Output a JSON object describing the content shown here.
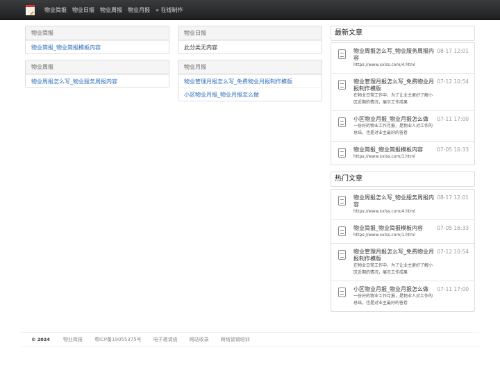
{
  "nav": {
    "items": [
      "物业简报",
      "物业日报",
      "物业周报",
      "物业月报",
      "« 在线制作"
    ]
  },
  "panels": [
    {
      "title": "物业简报",
      "rows": [
        {
          "text": "物业简报_物业简报模板内容",
          "link": true
        }
      ]
    },
    {
      "title": "物业周报",
      "rows": [
        {
          "text": "物业周报怎么写_物业服务周报内容",
          "link": true
        }
      ]
    },
    {
      "title": "物业日报",
      "rows": [
        {
          "text": "此分类无内容",
          "link": false
        }
      ]
    },
    {
      "title": "物业月报",
      "rows": [
        {
          "text": "物业管理月报怎么写_免费物业月报制作模版",
          "link": true
        },
        {
          "text": "小区物业月报_物业月报怎么做",
          "link": true
        }
      ]
    }
  ],
  "latest": {
    "title": "最新文章",
    "items": [
      {
        "title": "物业周报怎么写_物业服务周报内容",
        "sub": "https://www.xxlss.com/4.html",
        "date": "08-17 12:01"
      },
      {
        "title": "物业管理月报怎么写_免费物业月报制作模版",
        "sub": "在物业日常工作中，为了让业主更好了解小区近期的情况，展示工作成果",
        "date": "07-12 10:54"
      },
      {
        "title": "小区物业月报_物业月报怎么做",
        "sub": "一份好的物业工作月报，是物业人对工作的总结，也是对业主最好的答卷",
        "date": "07-11 17:00"
      },
      {
        "title": "物业简报_物业简报模板内容",
        "sub": "https://www.xxlss.com/1.html",
        "date": "07-05 16:33"
      }
    ]
  },
  "hot": {
    "title": "热门文章",
    "items": [
      {
        "title": "物业周报怎么写_物业服务周报内容",
        "sub": "https://www.xxlss.com/4.html",
        "date": "08-17 12:01"
      },
      {
        "title": "物业简报_物业简报模板内容",
        "sub": "https://www.xxlss.com/1.html",
        "date": "07-05 16:33"
      },
      {
        "title": "物业管理月报怎么写_免费物业月报制作模版",
        "sub": "在物业日常工作中，为了让业主更好了解小区近期的情况，展示工作成果",
        "date": "07-12 10:54"
      },
      {
        "title": "小区物业月报_物业月报怎么做",
        "sub": "一份好的物业工作月报，是物业人对工作的总结，也是对业主最好的答卷",
        "date": "07-11 17:00"
      }
    ]
  },
  "footer": {
    "copyright": "© 2024",
    "links": [
      "物业简报",
      "粤ICP备19055375号",
      "电子邀请函",
      "网站收录",
      "网络营销培训"
    ]
  }
}
